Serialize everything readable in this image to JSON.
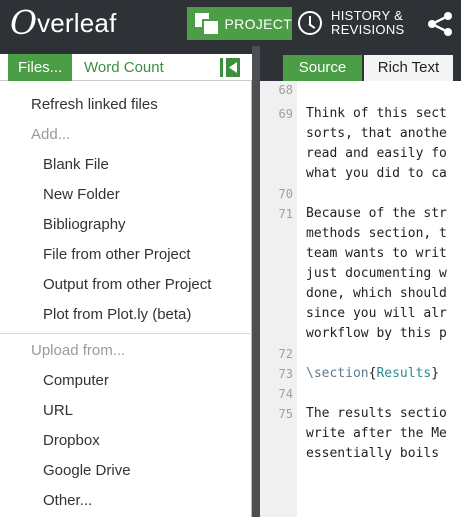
{
  "app": {
    "logo_initial": "O",
    "logo_rest": "verleaf"
  },
  "toolbar": {
    "project_label": "PROJECT",
    "history_label_line1": "HISTORY &",
    "history_label_line2": "REVISIONS",
    "share_icon": "share-icon"
  },
  "file_tabs": {
    "files_label": "Files...",
    "word_count_label": "Word Count",
    "collapse_icon": "collapse-left-icon"
  },
  "files_menu": {
    "refresh": "Refresh linked files",
    "add_header": "Add...",
    "add_items": [
      "Blank File",
      "New Folder",
      "Bibliography",
      "File from other Project",
      "Output from other Project",
      "Plot from Plot.ly (beta)"
    ],
    "upload_header": "Upload from...",
    "upload_items": [
      "Computer",
      "URL",
      "Dropbox",
      "Google Drive",
      "Other..."
    ]
  },
  "editor": {
    "source_tab": "Source",
    "rich_text_tab": "Rich Text",
    "lines": [
      {
        "n": "68",
        "text": ""
      },
      {
        "n": "69",
        "text": "Think of this sect"
      },
      {
        "n": "",
        "text": "sorts, that anothe"
      },
      {
        "n": "",
        "text": "read and easily fo"
      },
      {
        "n": "",
        "text": "what you did to ca"
      },
      {
        "n": "70",
        "text": ""
      },
      {
        "n": "71",
        "text": "Because of the str"
      },
      {
        "n": "",
        "text": "methods section, t"
      },
      {
        "n": "",
        "text": "team wants to writ"
      },
      {
        "n": "",
        "text": "just documenting w"
      },
      {
        "n": "",
        "text": "done, which should"
      },
      {
        "n": "",
        "text": "since you will alr"
      },
      {
        "n": "",
        "text": "workflow by this p"
      },
      {
        "n": "72",
        "text": ""
      },
      {
        "n": "73",
        "cmd": "\\section",
        "arg": "Results"
      },
      {
        "n": "74",
        "text": ""
      },
      {
        "n": "75",
        "text": "The results sectio"
      },
      {
        "n": "",
        "text": "write after the Me"
      },
      {
        "n": "",
        "text": "essentially boils"
      }
    ]
  },
  "colors": {
    "accent_green": "#4b9e46",
    "top_bar": "#2e3135"
  }
}
